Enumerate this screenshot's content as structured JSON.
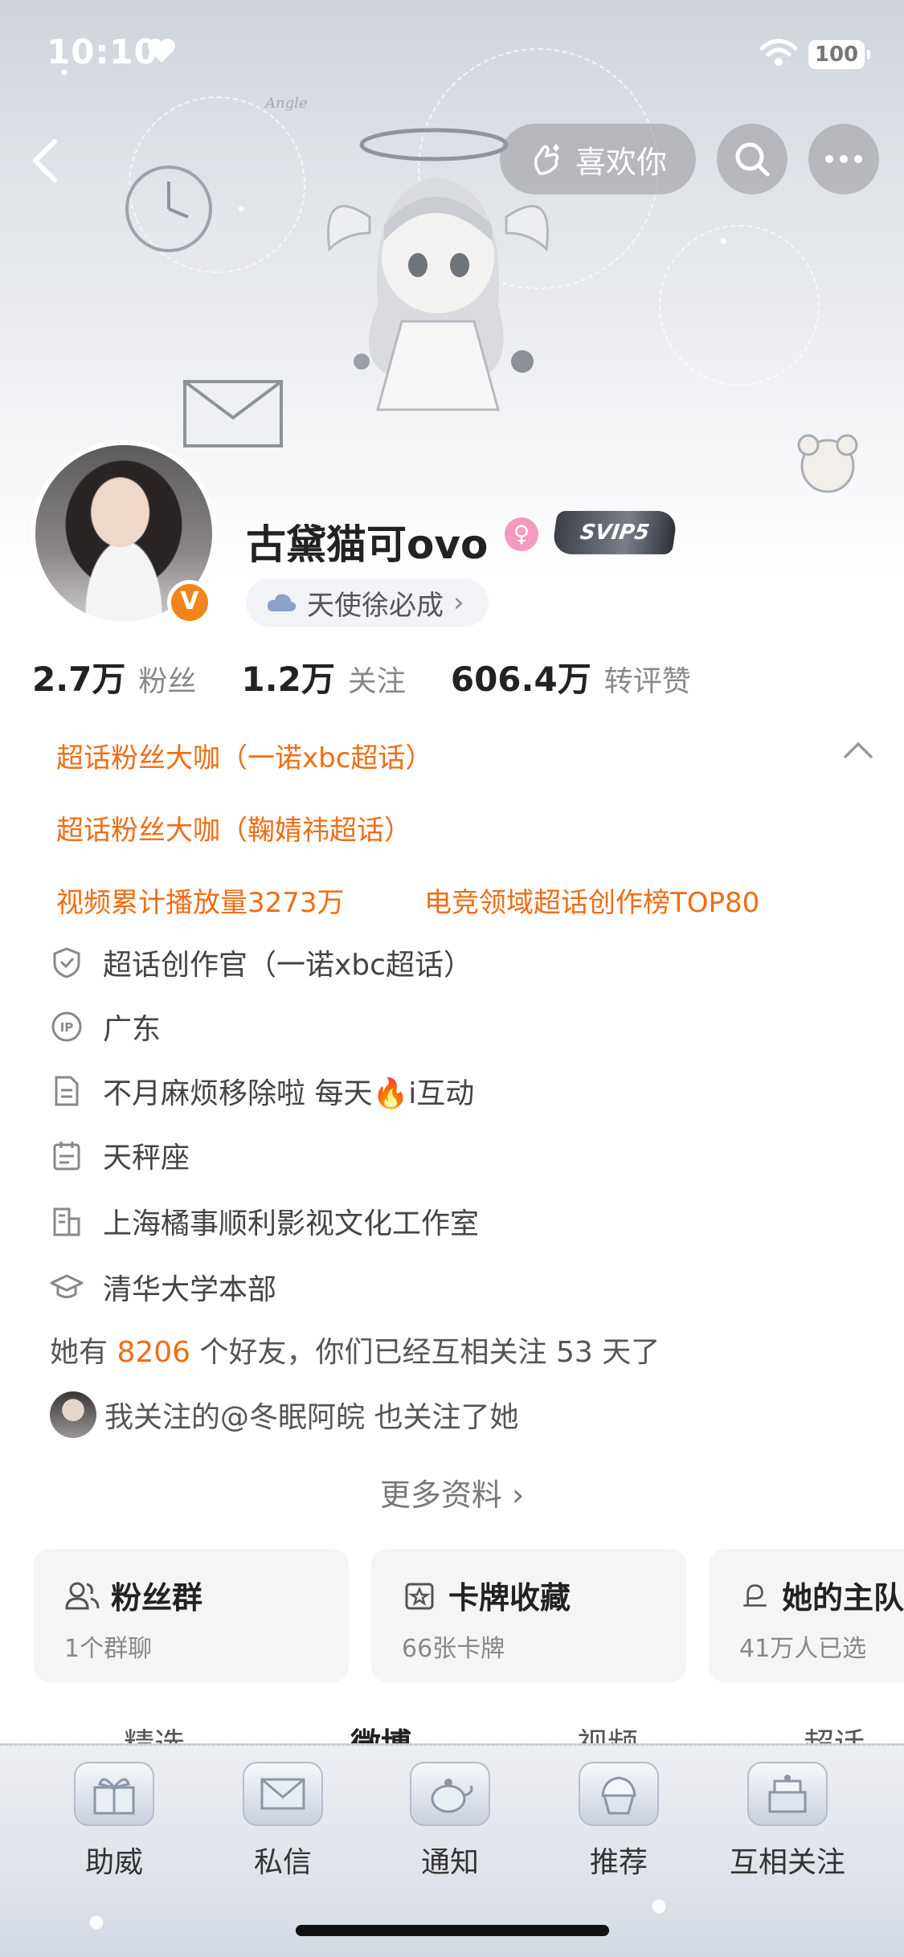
{
  "status_bar": {
    "time": "10:10",
    "battery": "100"
  },
  "header": {
    "like_label": "喜欢你"
  },
  "profile": {
    "name": "古黛猫可ovo",
    "vip_badge": "SVIP5",
    "v_badge": "V",
    "gender_symbol": "♀",
    "tag_label": "天使徐必成",
    "stats": [
      {
        "num": "2.7万",
        "label": "粉丝"
      },
      {
        "num": "1.2万",
        "label": "关注"
      },
      {
        "num": "606.4万",
        "label": "转评赞"
      }
    ]
  },
  "badges": {
    "line1": "超话粉丝大咖（一诺xbc超话）",
    "line2": "超话粉丝大咖（鞠婧祎超话）",
    "line3a": "视频累计播放量3273万",
    "line3b": "电竞领域超话创作榜TOP80"
  },
  "info": {
    "items": [
      {
        "icon": "shield-icon",
        "text": "超话创作官（一诺xbc超话）"
      },
      {
        "icon": "ip-icon",
        "text": "广东"
      },
      {
        "icon": "document-icon",
        "text": "不月麻烦移除啦 每天🔥i互动"
      },
      {
        "icon": "calendar-icon",
        "text": "天秤座"
      },
      {
        "icon": "company-icon",
        "text": "上海橘事顺利影视文化工作室"
      },
      {
        "icon": "graduation-cap-icon",
        "text": "清华大学本部"
      }
    ],
    "friends_prefix": "她有",
    "friends_count": "8206",
    "friends_suffix": "个好友，你们已经互相关注 53 天了",
    "mutual_text": "我关注的@冬眠阿皖 也关注了她",
    "more_label": "更多资料 ›"
  },
  "cards": [
    {
      "title": "粉丝群",
      "sub": "1个群聊",
      "icon": "group-icon"
    },
    {
      "title": "卡牌收藏",
      "sub": "66张卡牌",
      "icon": "card-icon"
    },
    {
      "title": "她的主队",
      "sub": "41万人已选",
      "icon": "team-icon"
    }
  ],
  "tabs": [
    "精选",
    "微博",
    "视频",
    "超话"
  ],
  "bottom_bar": [
    {
      "label": "助威",
      "icon": "gift-icon"
    },
    {
      "label": "私信",
      "icon": "message-icon"
    },
    {
      "label": "通知",
      "icon": "teapot-icon"
    },
    {
      "label": "推荐",
      "icon": "cupcake-icon"
    },
    {
      "label": "互相关注",
      "icon": "cake-icon"
    }
  ],
  "colors": {
    "accent_orange": "#ef6d14",
    "badge_orange": "#f0851c",
    "gender_pink": "#f59abf"
  }
}
